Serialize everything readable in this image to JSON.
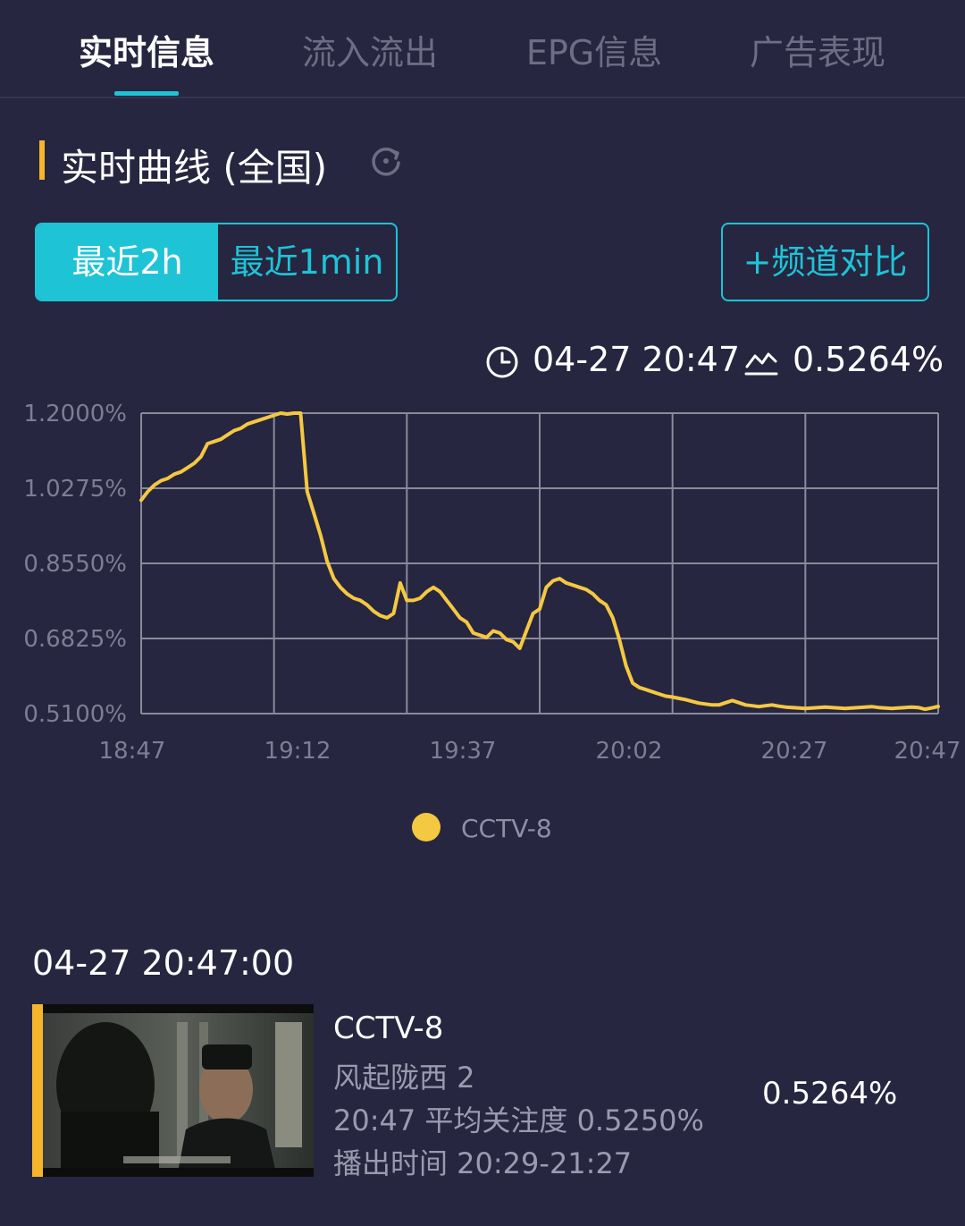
{
  "tabs": [
    {
      "label": "实时信息",
      "active": true
    },
    {
      "label": "流入流出",
      "active": false
    },
    {
      "label": "EPG信息",
      "active": false
    },
    {
      "label": "广告表现",
      "active": false
    }
  ],
  "section": {
    "title": "实时曲线 (全国)",
    "refresh_icon": "refresh-icon"
  },
  "range_toggle": {
    "option_2h": "最近2h",
    "option_1min": "最近1min",
    "selected": "最近2h"
  },
  "compare_button": "+频道对比",
  "readout": {
    "time": "04-27 20:47",
    "value": "0.5264%",
    "time_icon": "clock-icon",
    "value_icon": "trend-icon"
  },
  "chart_data": {
    "type": "line",
    "title": "",
    "xlabel": "",
    "ylabel": "",
    "y_tick_labels": [
      "1.2000%",
      "1.0275%",
      "0.8550%",
      "0.6825%",
      "0.5100%"
    ],
    "x_tick_labels": [
      "18:47",
      "19:12",
      "19:37",
      "20:02",
      "20:27",
      "20:47"
    ],
    "ylim": [
      0.51,
      1.2
    ],
    "x_range_minutes": [
      0,
      120
    ],
    "grid": true,
    "legend_position": "bottom",
    "series": [
      {
        "name": "CCTV-8",
        "color": "#f5c842",
        "x_minutes": [
          0,
          1,
          2,
          3,
          4,
          5,
          6,
          7,
          8,
          9,
          10,
          11,
          12,
          13,
          14,
          15,
          16,
          17,
          18,
          19,
          20,
          21,
          22,
          23,
          24,
          25,
          26,
          27,
          28,
          29,
          30,
          31,
          32,
          33,
          34,
          35,
          36,
          37,
          38,
          39,
          40,
          41,
          42,
          43,
          44,
          45,
          46,
          47,
          48,
          49,
          50,
          51,
          52,
          53,
          54,
          55,
          56,
          57,
          58,
          59,
          60,
          61,
          62,
          63,
          64,
          65,
          66,
          67,
          68,
          69,
          70,
          71,
          72,
          73,
          74,
          75,
          76,
          77,
          78,
          79,
          80,
          81,
          82,
          83,
          84,
          85,
          86,
          87,
          88,
          89,
          90,
          91,
          92,
          93,
          94,
          95,
          96,
          97,
          98,
          99,
          100,
          101,
          102,
          103,
          104,
          105,
          106,
          107,
          108,
          109,
          110,
          111,
          112,
          113,
          114,
          115,
          116,
          117,
          118,
          119,
          120
        ],
        "values": [
          1.0,
          1.02,
          1.035,
          1.045,
          1.05,
          1.06,
          1.065,
          1.075,
          1.085,
          1.1,
          1.13,
          1.135,
          1.14,
          1.15,
          1.16,
          1.165,
          1.175,
          1.18,
          1.185,
          1.19,
          1.195,
          1.2,
          1.198,
          1.2,
          1.2,
          1.02,
          0.97,
          0.92,
          0.86,
          0.82,
          0.8,
          0.785,
          0.775,
          0.77,
          0.76,
          0.745,
          0.735,
          0.73,
          0.74,
          0.81,
          0.77,
          0.77,
          0.775,
          0.79,
          0.8,
          0.79,
          0.77,
          0.75,
          0.73,
          0.72,
          0.695,
          0.69,
          0.685,
          0.7,
          0.695,
          0.68,
          0.675,
          0.66,
          0.7,
          0.74,
          0.75,
          0.8,
          0.815,
          0.82,
          0.81,
          0.805,
          0.8,
          0.795,
          0.785,
          0.77,
          0.76,
          0.73,
          0.68,
          0.62,
          0.58,
          0.57,
          0.565,
          0.56,
          0.555,
          0.55,
          0.548,
          0.545,
          0.542,
          0.538,
          0.534,
          0.532,
          0.53,
          0.53,
          0.535,
          0.54,
          0.535,
          0.53,
          0.528,
          0.526,
          0.528,
          0.53,
          0.527,
          0.525,
          0.524,
          0.523,
          0.522,
          0.523,
          0.524,
          0.525,
          0.524,
          0.523,
          0.522,
          0.523,
          0.524,
          0.525,
          0.526,
          0.524,
          0.523,
          0.522,
          0.523,
          0.524,
          0.525,
          0.524,
          0.52,
          0.523,
          0.5264
        ]
      }
    ]
  },
  "legend": {
    "label": "CCTV-8",
    "color": "#f5c842"
  },
  "snapshot": {
    "time": "04-27 20:47:00",
    "channel": "CCTV-8",
    "program": "风起陇西 2",
    "avg_attention": "20:47 平均关注度 0.5250%",
    "air_time": "播出时间 20:29-21:27",
    "value": "0.5264%"
  }
}
